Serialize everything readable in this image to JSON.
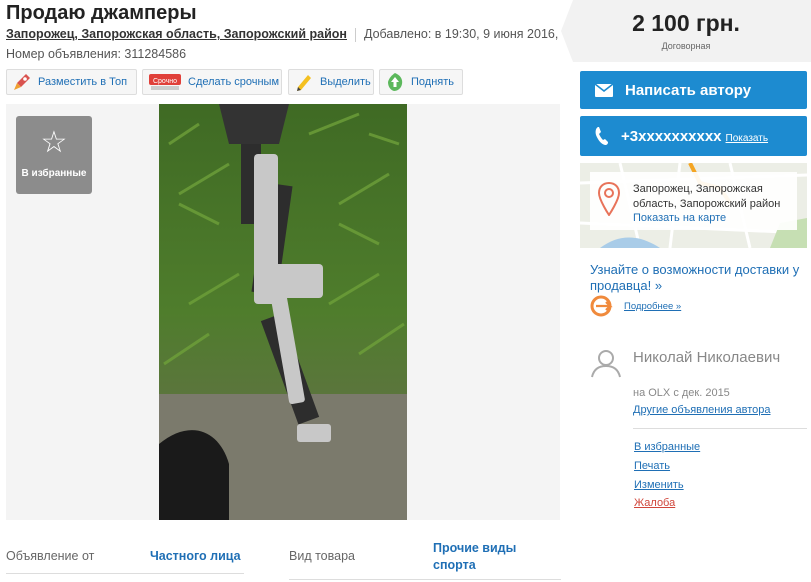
{
  "header": {
    "title": "Продаю джамперы",
    "location": "Запорожец, Запорожская область, Запорожский район",
    "added": "Добавлено: в 19:30, 9 июня 2016,",
    "ad_number": "Номер объявления: 311284586"
  },
  "actions": [
    {
      "label": "Разместить в Топ",
      "icon": "rocket-icon"
    },
    {
      "label": "Сделать срочным",
      "icon": "urgent-tag-icon",
      "badge": "Срочно"
    },
    {
      "label": "Выделить",
      "icon": "pencil-icon"
    },
    {
      "label": "Поднять",
      "icon": "up-arrow-icon"
    }
  ],
  "gallery": {
    "favorite_label": "В избранные"
  },
  "details": [
    {
      "label": "Объявление от",
      "value": "Частного лица"
    },
    {
      "label": "Вид товара",
      "value": "Прочие виды спорта"
    }
  ],
  "sidebar": {
    "price": "2 100 грн.",
    "price_note": "Договорная",
    "message_button": "Написать автору",
    "phone": "+3xxxxxxxxxx",
    "phone_show": "Показать",
    "map_location": "Запорожец, Запорожская область, Запорожский район",
    "map_link": "Показать на карте",
    "delivery_text": "Узнайте о возможности доставки у продавца! »",
    "more_link": "Подробнее »",
    "user_name": "Николай Николаевич",
    "user_since": "на OLX с дек. 2015",
    "other_ads": "Другие объявления автора",
    "links": [
      "В избранные",
      "Печать",
      "Изменить",
      "Жалоба"
    ]
  },
  "colors": {
    "accent": "#1d8bd0",
    "link": "#1f6fb5",
    "complaint": "#d0453a"
  }
}
